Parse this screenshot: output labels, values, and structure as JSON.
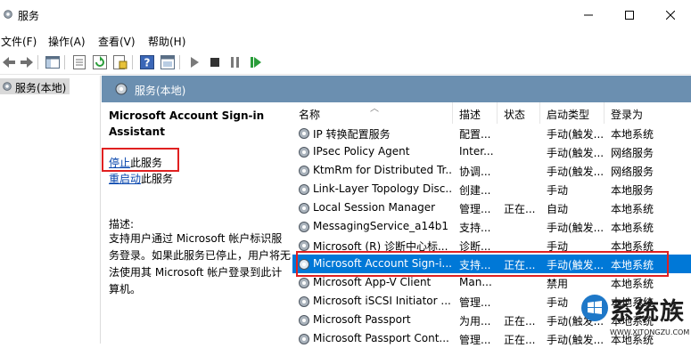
{
  "window": {
    "title": "服务",
    "icon": "services-gear-icon"
  },
  "menu": {
    "items": [
      "文件(F)",
      "操作(A)",
      "查看(V)",
      "帮助(H)"
    ]
  },
  "tree": {
    "node_label": "服务(本地)"
  },
  "main": {
    "header_title": "服务(本地)"
  },
  "details": {
    "service_name": "Microsoft Account Sign-in Assistant",
    "stop_link": "停止",
    "stop_suffix": "此服务",
    "restart_link": "重启动",
    "restart_suffix": "此服务",
    "desc_label": "描述:",
    "desc_text": "支持用户通过 Microsoft 帐户标识服务登录。如果此服务已停止，用户将无法使用其 Microsoft 帐户登录到此计算机。"
  },
  "columns": [
    "名称",
    "描述",
    "状态",
    "启动类型",
    "登录为"
  ],
  "rows": [
    {
      "name": "IP 转换配置服务",
      "desc": "配置...",
      "status": "",
      "startup": "手动(触发...",
      "logon": "本地系统"
    },
    {
      "name": "IPsec Policy Agent",
      "desc": "Inter...",
      "status": "",
      "startup": "手动(触发...",
      "logon": "网络服务"
    },
    {
      "name": "KtmRm for Distributed Tr...",
      "desc": "协调...",
      "status": "",
      "startup": "手动(触发...",
      "logon": "网络服务"
    },
    {
      "name": "Link-Layer Topology Disc...",
      "desc": "创建...",
      "status": "",
      "startup": "手动",
      "logon": "本地服务"
    },
    {
      "name": "Local Session Manager",
      "desc": "管理...",
      "status": "正在...",
      "startup": "自动",
      "logon": "本地系统"
    },
    {
      "name": "MessagingService_a14b1",
      "desc": "支持...",
      "status": "",
      "startup": "手动(触发...",
      "logon": "本地系统"
    },
    {
      "name": "Microsoft (R) 诊断中心标...",
      "desc": "诊断...",
      "status": "",
      "startup": "手动",
      "logon": "本地系统"
    },
    {
      "name": "Microsoft Account Sign-i...",
      "desc": "支持...",
      "status": "正在...",
      "startup": "手动(触发...",
      "logon": "本地系统"
    },
    {
      "name": "Microsoft App-V Client",
      "desc": "Man...",
      "status": "",
      "startup": "禁用",
      "logon": "本地系统"
    },
    {
      "name": "Microsoft iSCSI Initiator ...",
      "desc": "管理...",
      "status": "",
      "startup": "手动",
      "logon": "本地系统"
    },
    {
      "name": "Microsoft Passport",
      "desc": "为用...",
      "status": "正在...",
      "startup": "手动(触发...",
      "logon": "本地系统"
    },
    {
      "name": "Microsoft Passport Cont...",
      "desc": "管理...",
      "status": "正在...",
      "startup": "手动(触发...",
      "logon": "本地系统"
    }
  ],
  "selected_row": 7,
  "colors": {
    "accent": "#0078d7",
    "header_bar": "#6b8fb0",
    "highlight_box": "#e02020",
    "link": "#0645ad"
  },
  "watermark": {
    "text": "系统族",
    "sub": "WWW.XITONGZU.COM"
  }
}
